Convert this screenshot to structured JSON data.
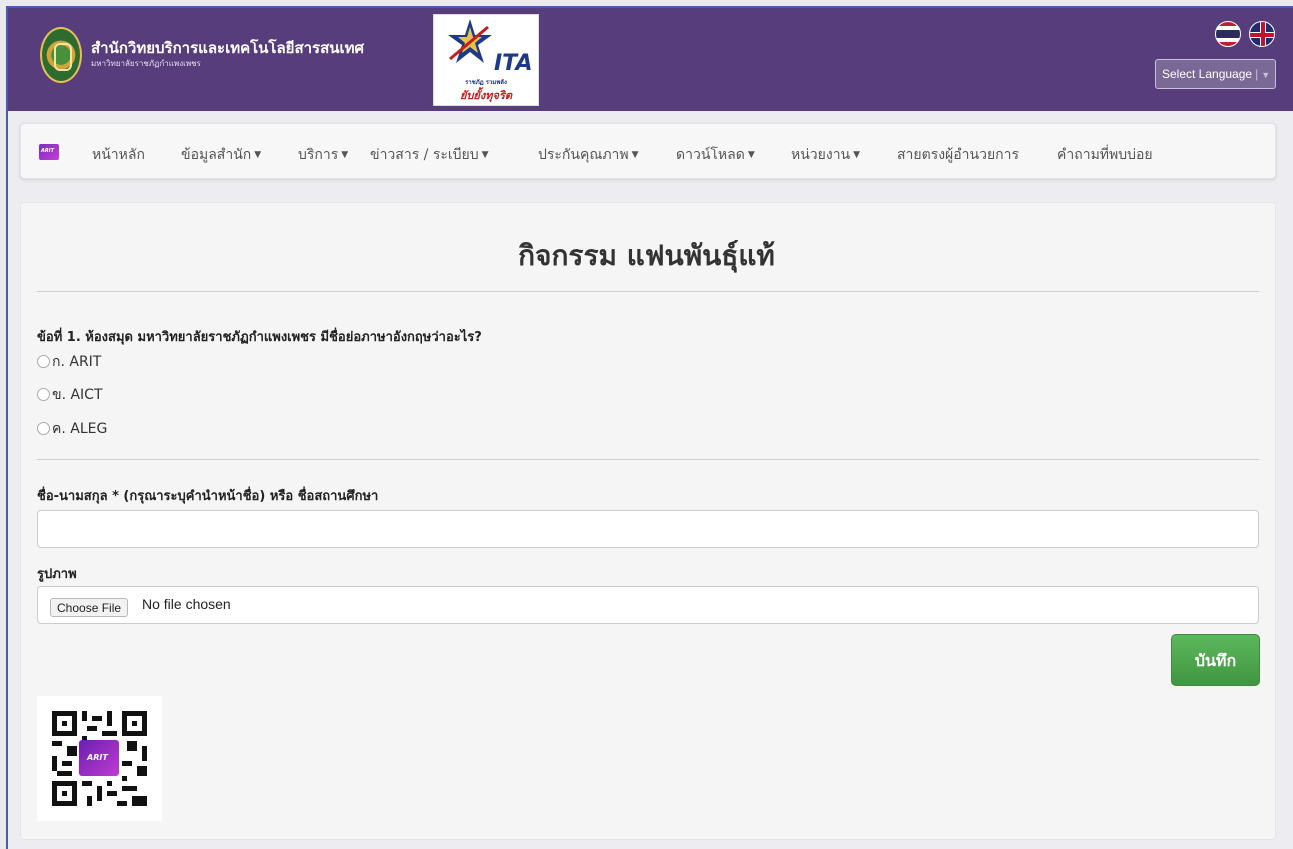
{
  "header": {
    "org_title": "สำนักวิทยบริการและเทคโนโลยีสารสนเทศ",
    "org_subtitle": "มหาวิทยาลัยราชภัฏกำแพงเพชร",
    "ita_logo": {
      "text": "ITA",
      "line1": "ราชภัฏ รวมพลัง",
      "line2": "ยับยั้งทุจริต"
    },
    "language_select": {
      "label": "Select Language",
      "separator": "|",
      "caret": "▼"
    },
    "flags": [
      "thai-flag-icon",
      "uk-flag-icon"
    ]
  },
  "navbar": {
    "brand_icon": "arit-logo-icon",
    "items": [
      {
        "label": "หน้าหลัก",
        "dropdown": false
      },
      {
        "label": "ข้อมูลสำนัก",
        "dropdown": true
      },
      {
        "label": "บริการ",
        "dropdown": true
      },
      {
        "label": "ข่าวสาร / ระเบียบ",
        "dropdown": true
      },
      {
        "label": "ประกันคุณภาพ",
        "dropdown": true
      },
      {
        "label": "ดาวน์โหลด",
        "dropdown": true
      },
      {
        "label": "หน่วยงาน",
        "dropdown": true
      },
      {
        "label": "สายตรงผู้อำนวยการ",
        "dropdown": false
      },
      {
        "label": "คำถามที่พบบ่อย",
        "dropdown": false
      }
    ],
    "caret": "▼"
  },
  "main": {
    "title": "กิจกรรม แฟนพันธุ์แท้",
    "question": "ข้อที่ 1. ห้องสมุด มหาวิทยาลัยราชภัฏกำแพงเพชร มีชื่อย่อภาษาอังกฤษว่าอะไร?",
    "options": [
      "ก. ARIT",
      "ข. AICT",
      "ค. ALEG"
    ],
    "name_label": "ชื่อ-นามสกุล * (กรุณาระบุคำนำหน้าชื่อ) หรือ ชื่อสถานศึกษา",
    "name_value": "",
    "image_label": "รูปภาพ",
    "file_button": "Choose File",
    "file_status": "No file chosen",
    "save_button": "บันทึก"
  }
}
